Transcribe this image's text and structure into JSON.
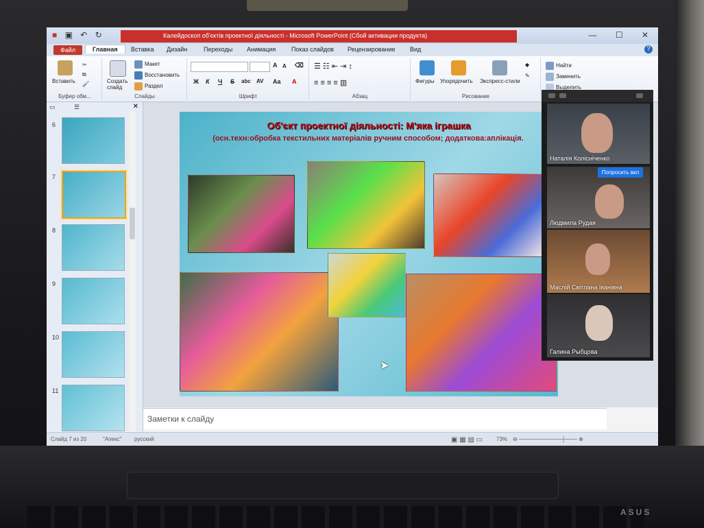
{
  "window": {
    "title": "Калейдоскоп об'єктів проектної діяльності  -  Microsoft PowerPoint (Сбой активации продукта)",
    "minimize": "—",
    "maximize": "☐",
    "close": "✕"
  },
  "tabs": [
    "Файл",
    "Главная",
    "Вставка",
    "Дизайн",
    "Переходы",
    "Анимация",
    "Показ слайдов",
    "Рецензирование",
    "Вид"
  ],
  "ribbon": {
    "clipboard": {
      "paste": "Вставить",
      "group": "Буфер обм..."
    },
    "slides": {
      "new": "Создать слайд",
      "layout": "Макет",
      "reset": "Восстановить",
      "section": "Раздел",
      "group": "Слайды"
    },
    "font": {
      "group": "Шрифт",
      "bold": "Ж",
      "italic": "К",
      "underline": "Ч",
      "strike": "S",
      "shadow": "abc",
      "spacing": "AV",
      "case": "Aa",
      "grow": "A",
      "shrink": "A",
      "color": "A"
    },
    "paragraph": {
      "group": "Абзац"
    },
    "drawing": {
      "shapes": "Фигуры",
      "arrange": "Упорядочить",
      "styles": "Экспресс-стили",
      "group": "Рисование"
    },
    "editing": {
      "find": "Найти",
      "replace": "Заменить",
      "select": "Выделить"
    }
  },
  "slide_panel": {
    "thumbs": [
      "6",
      "7",
      "8",
      "9",
      "10",
      "11"
    ],
    "selected": "7"
  },
  "slide": {
    "title": "Об'єкт проектної діяльності: М'яка іграшка",
    "subtitle": "(осн.техн:обробка текстильних матеріалів ручним способом; додаткова:аплікація."
  },
  "notes": {
    "placeholder": "Заметки к слайду"
  },
  "status": {
    "slide": "Слайд 7 из 20",
    "theme": "\"Апекс\"",
    "language": "русский",
    "zoom": "73%"
  },
  "zoom_call": {
    "participants": [
      {
        "name": "Наталія Колісніченко"
      },
      {
        "name": "Людмила Рудая"
      },
      {
        "name": "Маслій Світлана Іванівна"
      },
      {
        "name": "Галина Рыбцова"
      }
    ],
    "action": "Попросить вкл"
  },
  "laptop": {
    "brand": "ASUS"
  }
}
